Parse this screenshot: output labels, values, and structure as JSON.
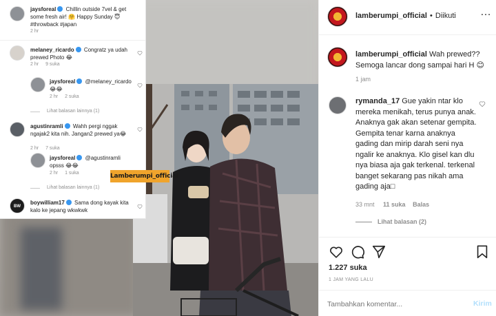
{
  "overlay": {
    "post_caption": {
      "username": "jaysforeal",
      "text": "Chillin outside 7vel & get some fresh air! 🤗 Happy Sunday 😇 #throwback #japan",
      "time": "2 hr"
    },
    "comments": [
      {
        "username": "melaney_ricardo",
        "text": "Congratz ya udah prewed Photo 😂",
        "time": "2 hr",
        "likes": "9 suka"
      },
      {
        "username": "jaysforeal",
        "text": "@melaney_ricardo 😂😂",
        "time": "2 hr",
        "likes": "2 suka",
        "reply": true
      },
      {
        "view_replies": "Lihat balasan lainnya (1)"
      },
      {
        "username": "agustinramli",
        "text": "Wahh pergi nggak ngajak2 kita nih. Jangan2 prewed ya😂",
        "time": "2 hr",
        "likes": "7 suka"
      },
      {
        "username": "jaysforeal",
        "text": "@agustinramli opsss 😂😂",
        "time": "2 hr",
        "likes": "1 suka",
        "reply": true
      },
      {
        "view_replies": "Lihat balasan lainnya (1)"
      },
      {
        "username": "boywilliam17",
        "text": "Sama dong kayak kita kalo ke jepang wkwkwk",
        "avatar_text": "BW"
      }
    ],
    "watermark": "Lamberumpi_official"
  },
  "header": {
    "username": "lamberumpi_official",
    "separator": "•",
    "follow_status": "Diikuti",
    "more": "…"
  },
  "caption": {
    "username": "lamberumpi_official",
    "text": "Wah prewed?? Semoga lancar dong sampai hari H 😊",
    "time": "1 jam"
  },
  "comment": {
    "username": "rymanda_17",
    "text": "Gue yakin ntar klo mereka menikah, terus punya anak. Anaknya gak akan setenar gempita. Gempita tenar karna anaknya gading dan mirip darah seni nya ngalir ke anaknya. Klo gisel kan dlu nya biasa aja gak terkenal. terkenal banget sekarang pas nikah ama gading aja□",
    "time": "33 mnt",
    "likes": "11 suka",
    "reply_label": "Balas",
    "view_replies": "Lihat balasan (2)"
  },
  "actions": {
    "likes": "1.227 suka",
    "timestamp": "1 JAM YANG LALU"
  },
  "composer": {
    "placeholder": "Tambahkan komentar...",
    "submit": "Kirim"
  },
  "colors": {
    "link": "#3897f0",
    "submit_disabled": "#b2dffc",
    "watermark_bg": "#f0a42c"
  }
}
